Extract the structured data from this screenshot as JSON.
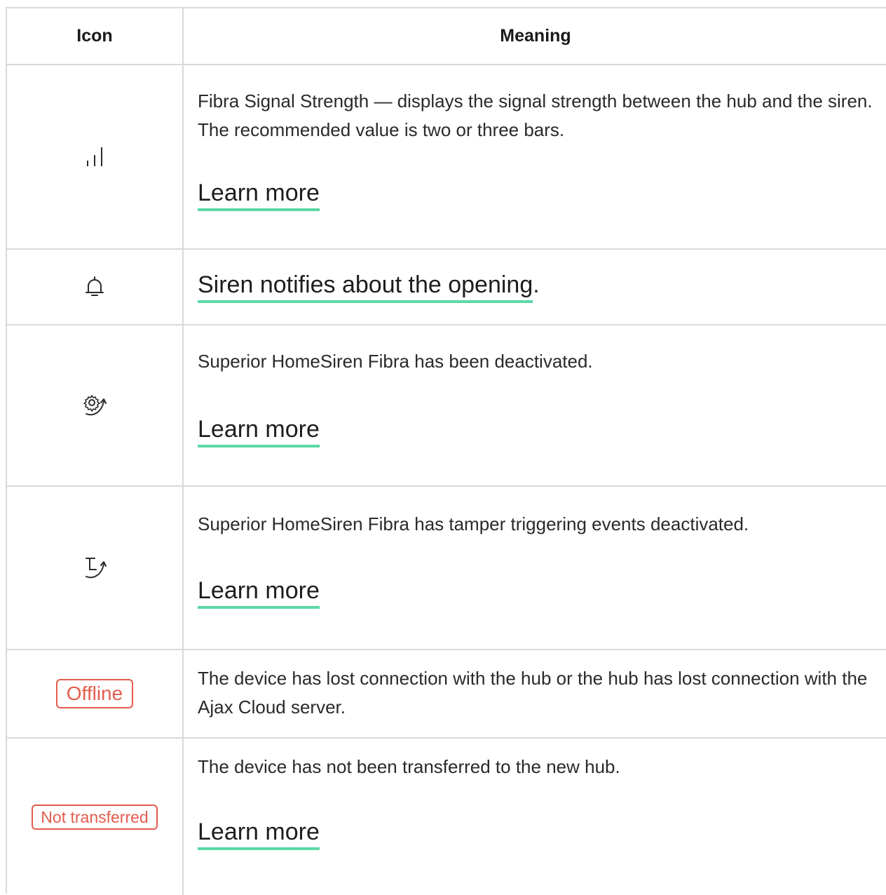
{
  "table": {
    "headers": {
      "icon": "Icon",
      "meaning": "Meaning"
    },
    "rows": [
      {
        "icon": "signal-bars-icon",
        "description": "Fibra Signal Strength — displays the signal strength between the hub and the siren. The recommended value is two or three bars.",
        "link": "Learn more"
      },
      {
        "icon": "bell-icon",
        "link": "Siren notifies about the opening",
        "suffix": "."
      },
      {
        "icon": "gear-arrow-icon",
        "description": "Superior HomeSiren Fibra has been deactivated.",
        "link": "Learn more"
      },
      {
        "icon": "tamper-arrow-icon",
        "description": "Superior HomeSiren Fibra has tamper triggering events deactivated.",
        "link": "Learn more"
      },
      {
        "badge": "Offline",
        "description": "The device has lost connection with the hub or the hub has lost connection with the Ajax Cloud server."
      },
      {
        "badge": "Not transferred",
        "description": "The device has not been transferred to the new hub.",
        "link": "Learn more"
      }
    ]
  },
  "colors": {
    "border": "#d9d9d9",
    "link_underline": "#5ad9a6",
    "badge_red": "#e25c4c"
  }
}
